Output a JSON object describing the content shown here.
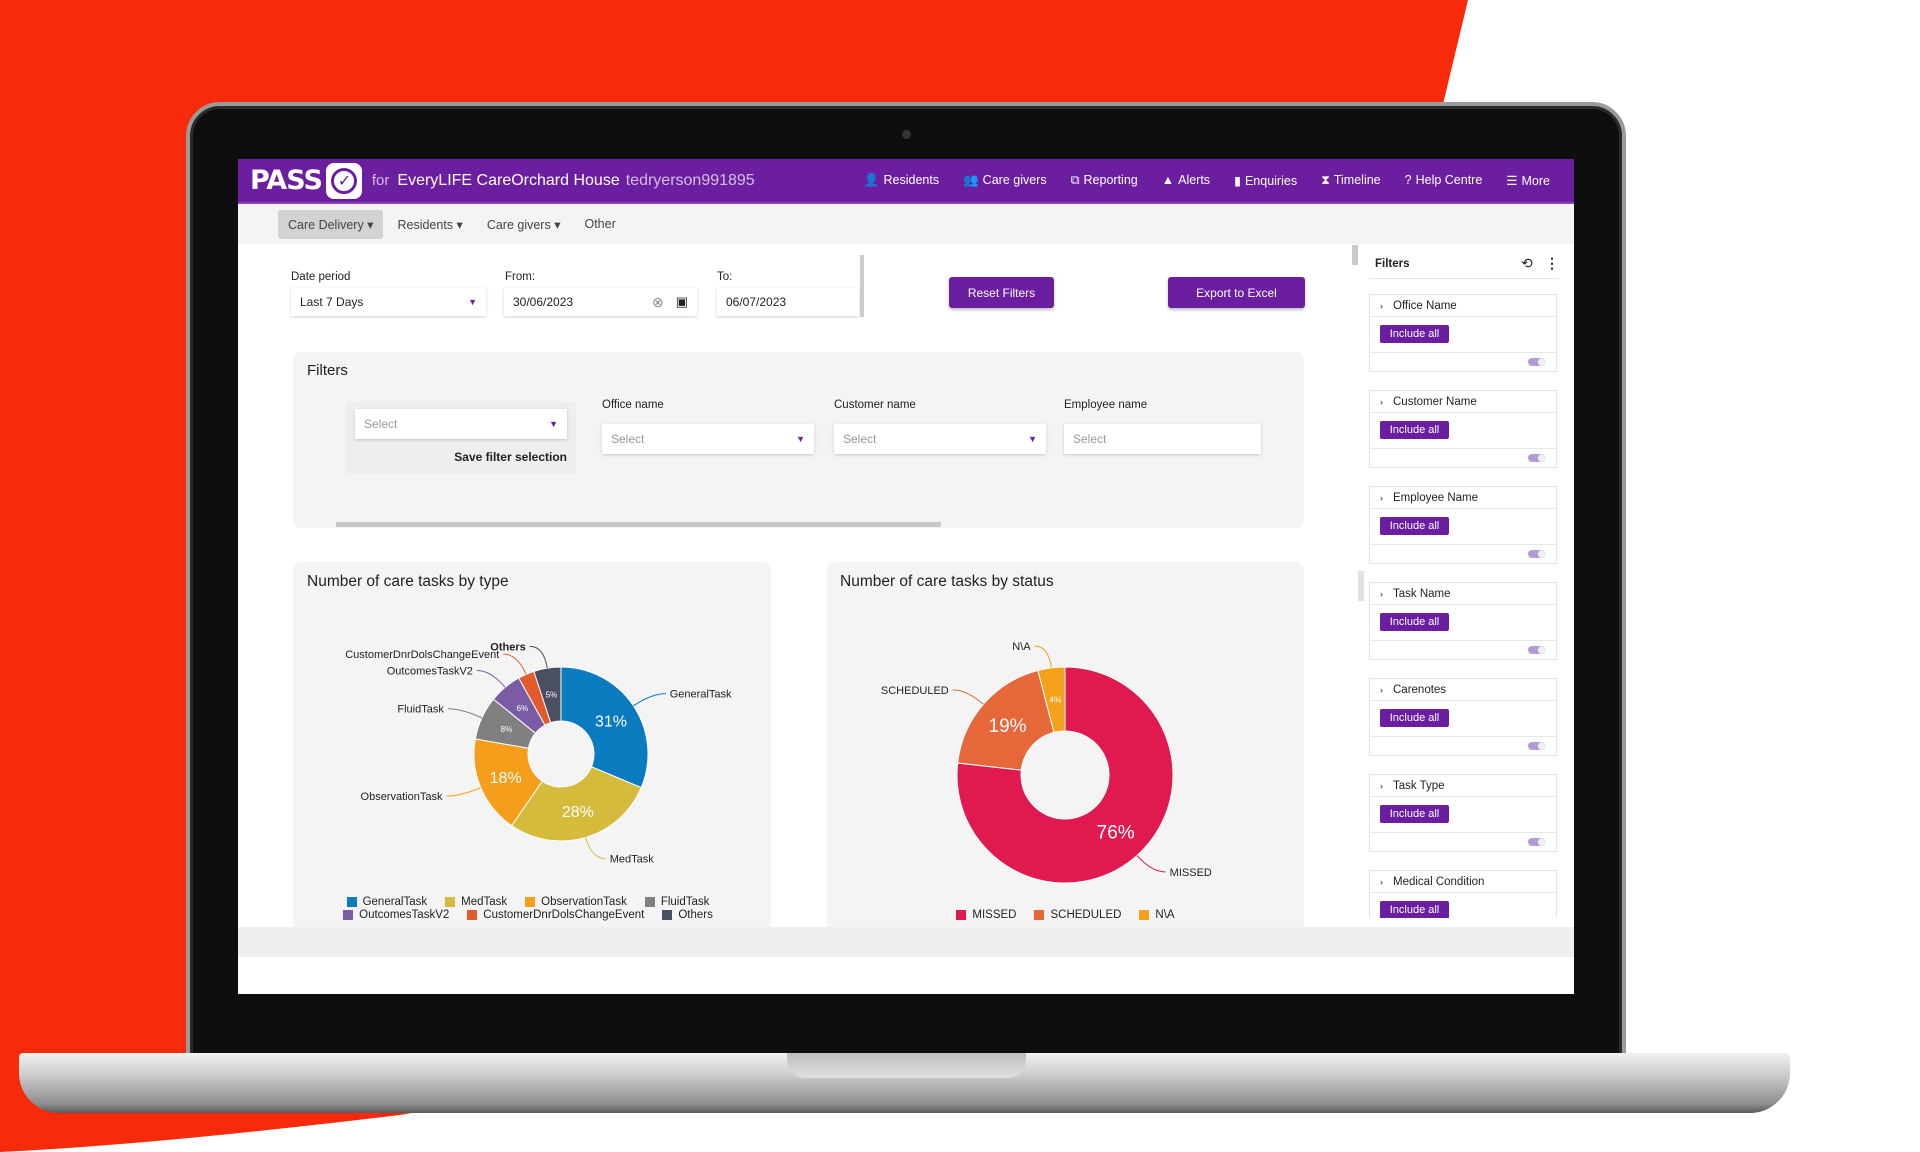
{
  "nav": {
    "logo": "PASS",
    "for": "for",
    "site": "EveryLIFE CareOrchard House",
    "user": "tedryerson991895",
    "items": [
      {
        "icon": "user-icon",
        "g": "👤",
        "label": "Residents"
      },
      {
        "icon": "users-icon",
        "g": "👥",
        "label": "Care givers"
      },
      {
        "icon": "reporting-icon",
        "g": "⧉",
        "label": "Reporting"
      },
      {
        "icon": "alert-icon",
        "g": "▲",
        "label": "Alerts"
      },
      {
        "icon": "document-icon",
        "g": "▮",
        "label": "Enquiries"
      },
      {
        "icon": "hourglass-icon",
        "g": "⧗",
        "label": "Timeline"
      },
      {
        "icon": "help-icon",
        "g": "?",
        "label": "Help Centre"
      },
      {
        "icon": "menu-icon",
        "g": "☰",
        "label": "More"
      }
    ]
  },
  "subnav": [
    {
      "label": "Care Delivery ▾",
      "active": true
    },
    {
      "label": "Residents ▾"
    },
    {
      "label": "Care givers ▾"
    },
    {
      "label": "Other"
    }
  ],
  "dates": {
    "period_label": "Date period",
    "period_value": "Last 7 Days",
    "from_label": "From:",
    "from_value": "30/06/2023",
    "to_label": "To:",
    "to_value": "06/07/2023"
  },
  "actions": {
    "reset": "Reset Filters",
    "export": "Export to Excel"
  },
  "filters": {
    "title": "Filters",
    "saved_placeholder": "Select",
    "save_label": "Save filter selection",
    "office_label": "Office name",
    "office_placeholder": "Select",
    "customer_label": "Customer name",
    "customer_placeholder": "Select",
    "employee_label": "Employee name",
    "employee_placeholder": "Select"
  },
  "side": {
    "title": "Filters",
    "include": "Include all",
    "sections": [
      "Office Name",
      "Customer Name",
      "Employee Name",
      "Task Name",
      "Carenotes",
      "Task Type",
      "Medical Condition"
    ]
  },
  "chart_data": [
    {
      "type": "pie",
      "donut": true,
      "title": "Number of care tasks by type",
      "legend": "bottom",
      "slices": [
        {
          "name": "GeneralTask",
          "value": 31,
          "label": "31%",
          "color": "#0b7bbf"
        },
        {
          "name": "MedTask",
          "value": 28,
          "label": "28%",
          "color": "#d4bb3c"
        },
        {
          "name": "ObservationTask",
          "value": 18,
          "label": "18%",
          "color": "#f59e1b"
        },
        {
          "name": "FluidTask",
          "value": 8,
          "label": "8%",
          "color": "#808080"
        },
        {
          "name": "OutcomesTaskV2",
          "value": 6,
          "label": "6%",
          "color": "#7a5ca6"
        },
        {
          "name": "CustomerDnrDolsChangeEvent",
          "value": 3,
          "label": "",
          "color": "#e35b2d"
        },
        {
          "name": "Others",
          "value": 5,
          "label": "5%",
          "color": "#4a5061"
        }
      ]
    },
    {
      "type": "pie",
      "donut": true,
      "title": "Number of care tasks by status",
      "legend": "bottom",
      "slices": [
        {
          "name": "MISSED",
          "value": 76,
          "label": "76%",
          "color": "#e01a4f"
        },
        {
          "name": "SCHEDULED",
          "value": 19,
          "label": "19%",
          "color": "#e5673a"
        },
        {
          "name": "N\\A",
          "value": 4,
          "label": "4%",
          "color": "#f5a11b"
        }
      ]
    }
  ]
}
